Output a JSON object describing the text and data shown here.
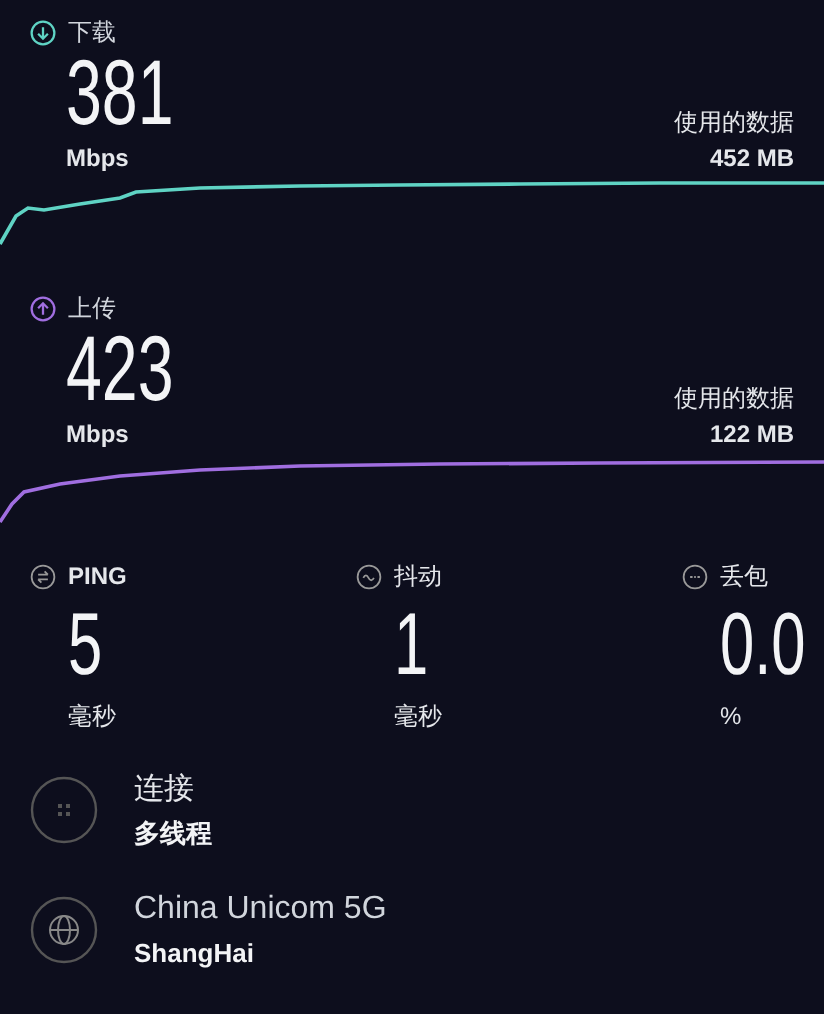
{
  "tests": [
    {
      "kind": "download",
      "label": "下载",
      "value": "381",
      "unit": "Mbps",
      "data_label": "使用的数据",
      "data_value": "452 MB"
    },
    {
      "kind": "upload",
      "label": "上传",
      "value": "423",
      "unit": "Mbps",
      "data_label": "使用的数据",
      "data_value": "122 MB"
    }
  ],
  "metrics": [
    {
      "kind": "ping",
      "label": "PING",
      "value": "5",
      "unit": "毫秒"
    },
    {
      "kind": "jitter",
      "label": "抖动",
      "value": "1",
      "unit": "毫秒"
    },
    {
      "kind": "loss",
      "label": "丢包",
      "value": "0.0",
      "unit": "%"
    }
  ],
  "connection": {
    "label": "连接",
    "value": "多线程"
  },
  "server": {
    "name": "China Unicom 5G",
    "location": "ShangHai"
  }
}
